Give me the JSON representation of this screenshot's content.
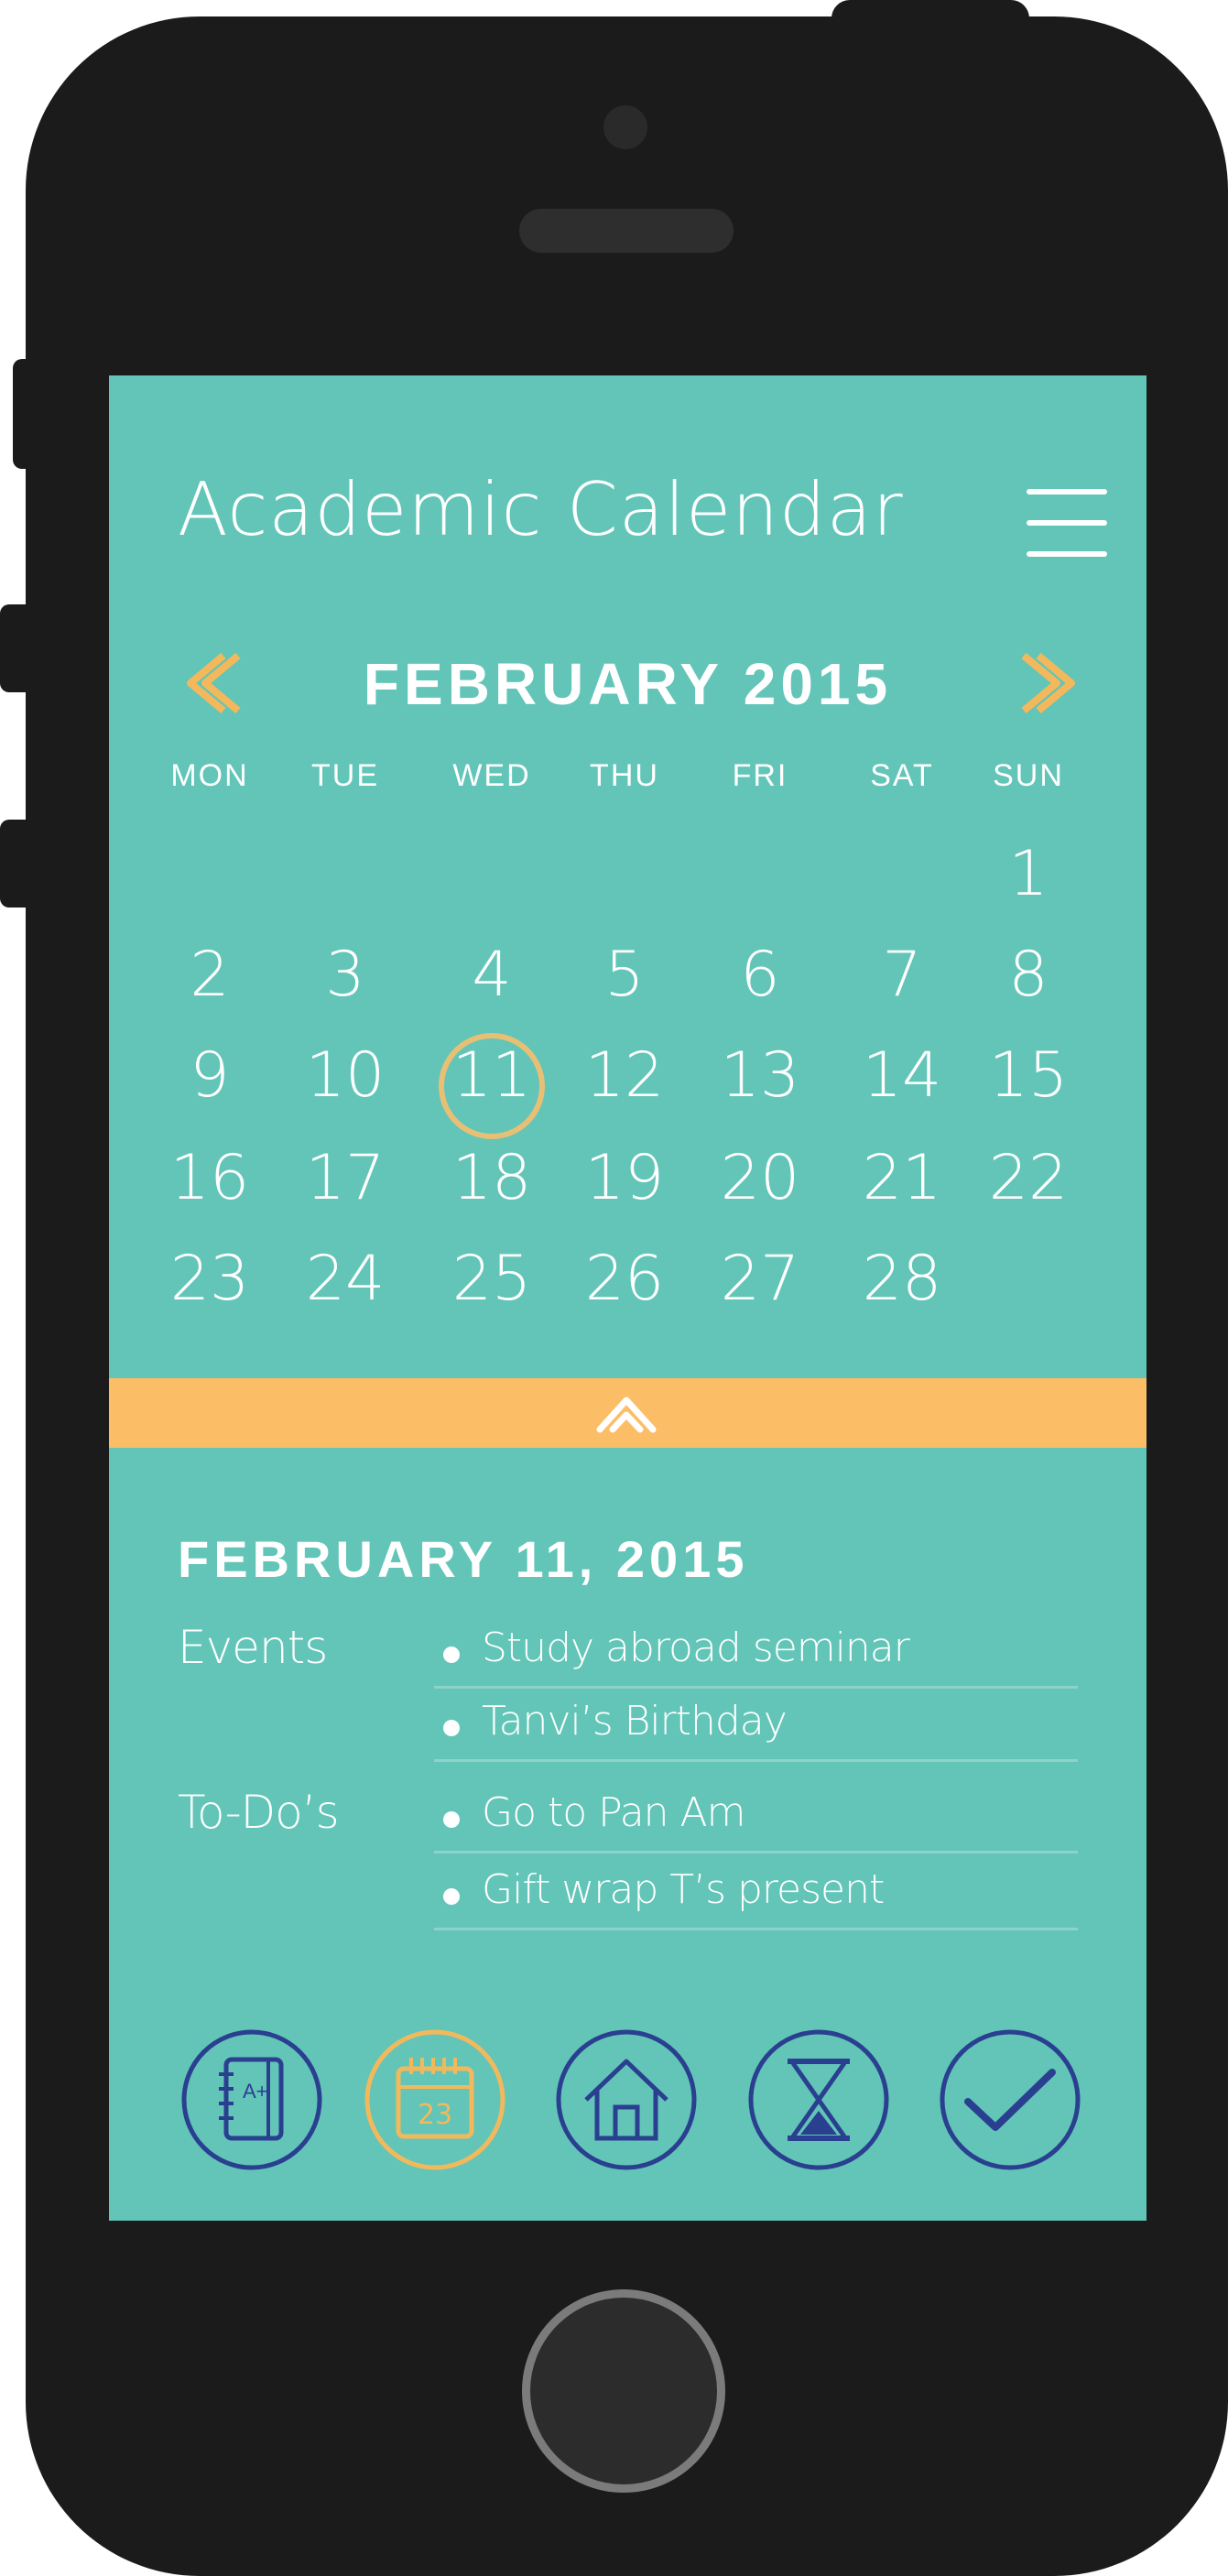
{
  "app": {
    "title": "Academic Calendar"
  },
  "calendar": {
    "month_label": "FEBRUARY 2015",
    "weekdays": [
      "MON",
      "TUE",
      "WED",
      "THU",
      "FRI",
      "SAT",
      "SUN"
    ],
    "weeks": [
      [
        "",
        "",
        "",
        "",
        "",
        "",
        "1"
      ],
      [
        "2",
        "3",
        "4",
        "5",
        "6",
        "7",
        "8"
      ],
      [
        "9",
        "10",
        "11",
        "12",
        "13",
        "14",
        "15"
      ],
      [
        "16",
        "17",
        "18",
        "19",
        "20",
        "21",
        "22"
      ],
      [
        "23",
        "24",
        "25",
        "26",
        "27",
        "28",
        ""
      ]
    ],
    "selected_day": "11"
  },
  "details": {
    "date_label": "FEBRUARY 11, 2015",
    "events_label": "Events",
    "events": [
      "Study abroad seminar",
      "Tanvi’s Birthday"
    ],
    "todos_label": "To-Do’s",
    "todos": [
      "Go to Pan Am",
      "Gift wrap T’s present"
    ]
  },
  "nav": {
    "items": [
      {
        "icon": "grades-notebook-icon",
        "calendar_day": ""
      },
      {
        "icon": "calendar-icon",
        "calendar_day": "23"
      },
      {
        "icon": "home-icon",
        "calendar_day": ""
      },
      {
        "icon": "hourglass-icon",
        "calendar_day": ""
      },
      {
        "icon": "checkmark-icon",
        "calendar_day": ""
      }
    ],
    "notebook_grade": "A+"
  },
  "colors": {
    "screen_bg": "#62c5b8",
    "accent": "#fbbd66",
    "selected_ring": "#e8c075",
    "nav_icon": "#2a3f8f",
    "nav_icon_active": "#f2b95c",
    "text": "#ffffff"
  }
}
